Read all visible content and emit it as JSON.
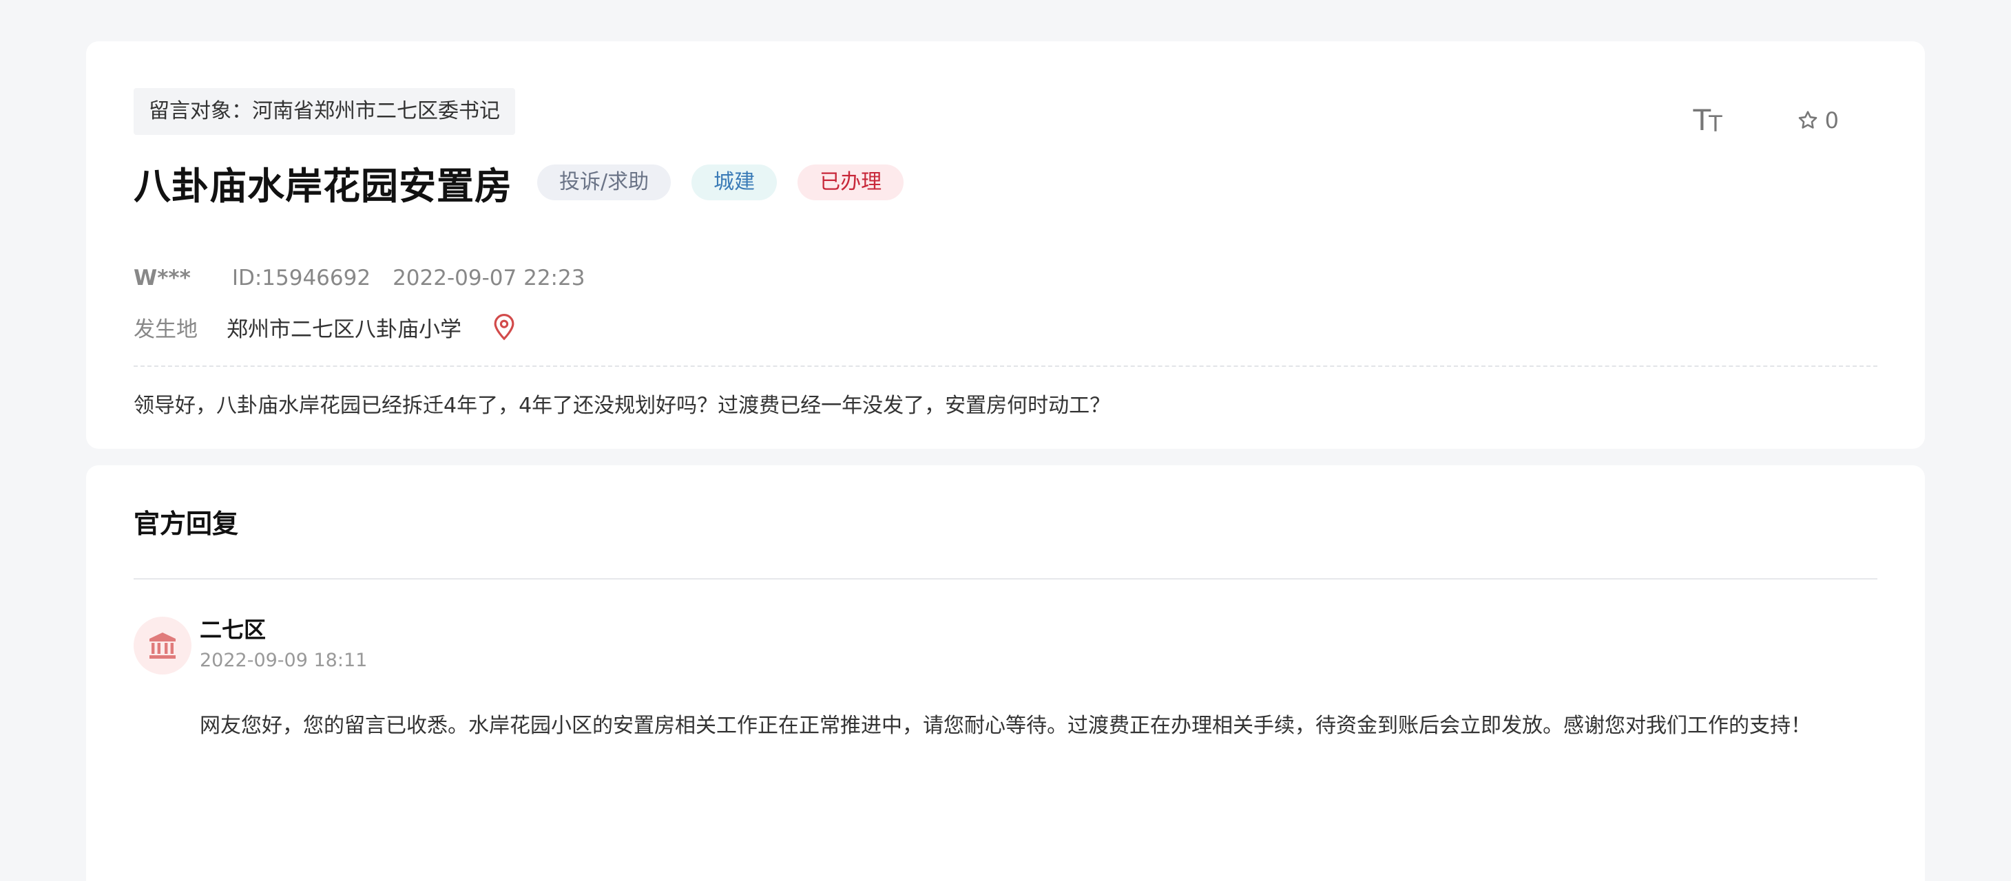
{
  "message": {
    "target_label": "留言对象：河南省郑州市二七区委书记",
    "title": "八卦庙水岸花园安置房",
    "tags": {
      "type": "投诉/求助",
      "category": "城建",
      "status": "已办理"
    },
    "toolbar": {
      "font_size_big": "T",
      "font_size_small": "T",
      "favorite_count": "0"
    },
    "author": "W***",
    "id": "ID:15946692",
    "datetime": "2022-09-07 22:23",
    "location_label": "发生地",
    "location_value": "郑州市二七区八卦庙小学",
    "content": "领导好，八卦庙水岸花园已经拆迁4年了，4年了还没规划好吗？过渡费已经一年没发了，安置房何时动工？"
  },
  "reply": {
    "heading": "官方回复",
    "author": "二七区",
    "datetime": "2022-09-09 18:11",
    "content": "网友您好，您的留言已收悉。水岸花园小区的安置房相关工作正在正常推进中，请您耐心等待。过渡费正在办理相关手续，待资金到账后会立即发放。感谢您对我们工作的支持！"
  },
  "icons": {
    "font_size": "font-size-icon",
    "favorite": "star-icon",
    "location": "location-pin-icon",
    "avatar": "government-building-icon"
  },
  "colors": {
    "page_bg": "#f5f6f8",
    "card_bg": "#ffffff",
    "tag_status": "#c8283a",
    "tag_category": "#3a7bb7",
    "location_pin": "#d24b4b",
    "avatar_icon": "#e07b7b"
  }
}
